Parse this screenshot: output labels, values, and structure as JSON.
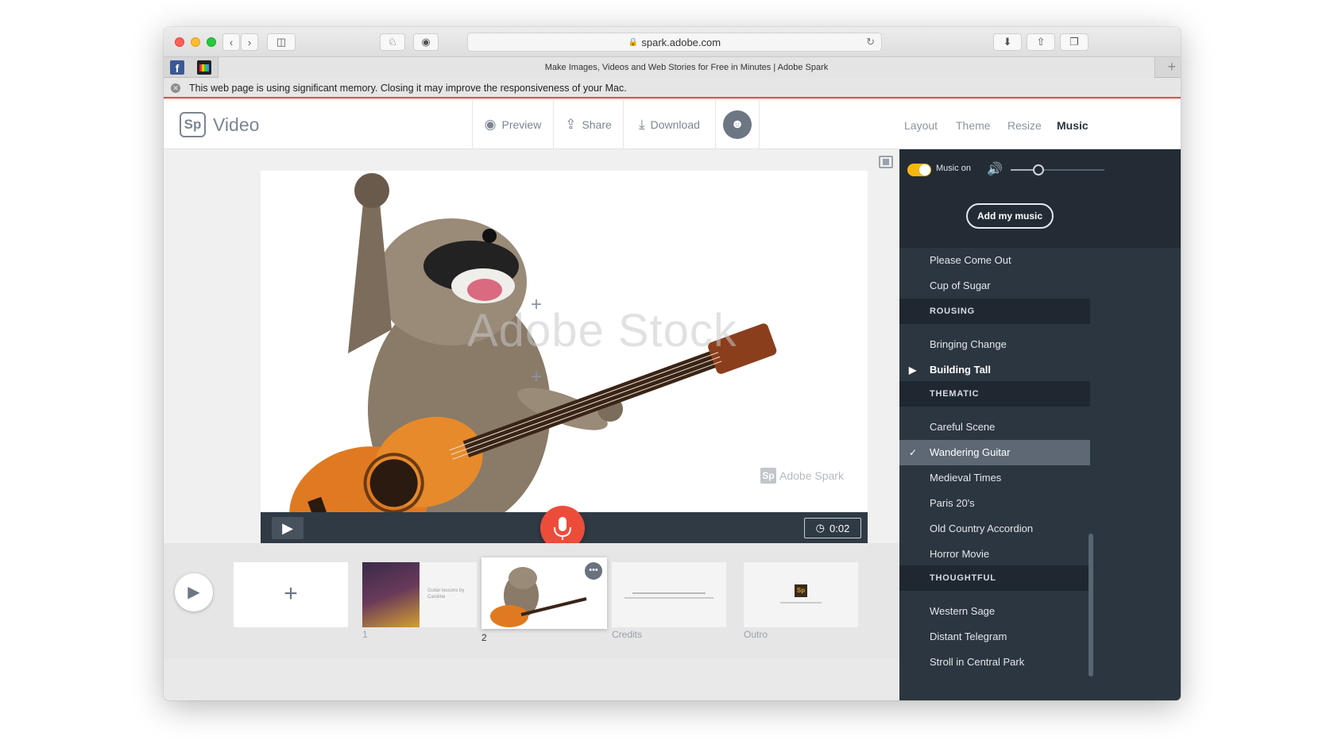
{
  "browser": {
    "url": "spark.adobe.com",
    "tab_title": "Make Images, Videos and Web Stories for Free in Minutes | Adobe Spark",
    "memory_warning": "This web page is using significant memory. Closing it may improve the responsiveness of your Mac."
  },
  "header": {
    "logo_mark": "Sp",
    "logo_text": "Video",
    "preview_label": "Preview",
    "share_label": "Share",
    "download_label": "Download",
    "nav": [
      "Layout",
      "Theme",
      "Resize",
      "Music"
    ],
    "active_nav": "Music"
  },
  "canvas": {
    "watermark": "Adobe Stock",
    "spark_mark": "Sp",
    "spark_watermark": "Adobe Spark",
    "duration": "0:02"
  },
  "timeline": {
    "slides": [
      {
        "number": "1",
        "caption": "Guitar lessons by Caroline"
      },
      {
        "number": "2",
        "caption": ""
      },
      {
        "number": "",
        "caption": "Credits"
      },
      {
        "number": "",
        "caption": "Outro"
      }
    ]
  },
  "music": {
    "toggle_label": "Music on",
    "add_label": "Add my music",
    "volume_level": 0.3,
    "rows": [
      {
        "type": "track",
        "label": "Please Come Out"
      },
      {
        "type": "track",
        "label": "Cup of Sugar"
      },
      {
        "type": "category",
        "label": "ROUSING"
      },
      {
        "type": "track",
        "label": "Bringing Change"
      },
      {
        "type": "track",
        "label": "Building Tall",
        "state": "playing"
      },
      {
        "type": "category",
        "label": "THEMATIC"
      },
      {
        "type": "track",
        "label": "Careful Scene"
      },
      {
        "type": "track",
        "label": "Wandering Guitar",
        "state": "selected"
      },
      {
        "type": "track",
        "label": "Medieval Times"
      },
      {
        "type": "track",
        "label": "Paris 20's"
      },
      {
        "type": "track",
        "label": "Old Country Accordion"
      },
      {
        "type": "track",
        "label": "Horror Movie"
      },
      {
        "type": "category",
        "label": "THOUGHTFUL"
      },
      {
        "type": "track",
        "label": "Western Sage"
      },
      {
        "type": "track",
        "label": "Distant Telegram"
      },
      {
        "type": "track",
        "label": "Stroll in Central Park"
      }
    ]
  },
  "colors": {
    "accent_red": "#ee4c3a",
    "toggle_yellow": "#f5b70f",
    "panel_bg": "#2c3640"
  }
}
